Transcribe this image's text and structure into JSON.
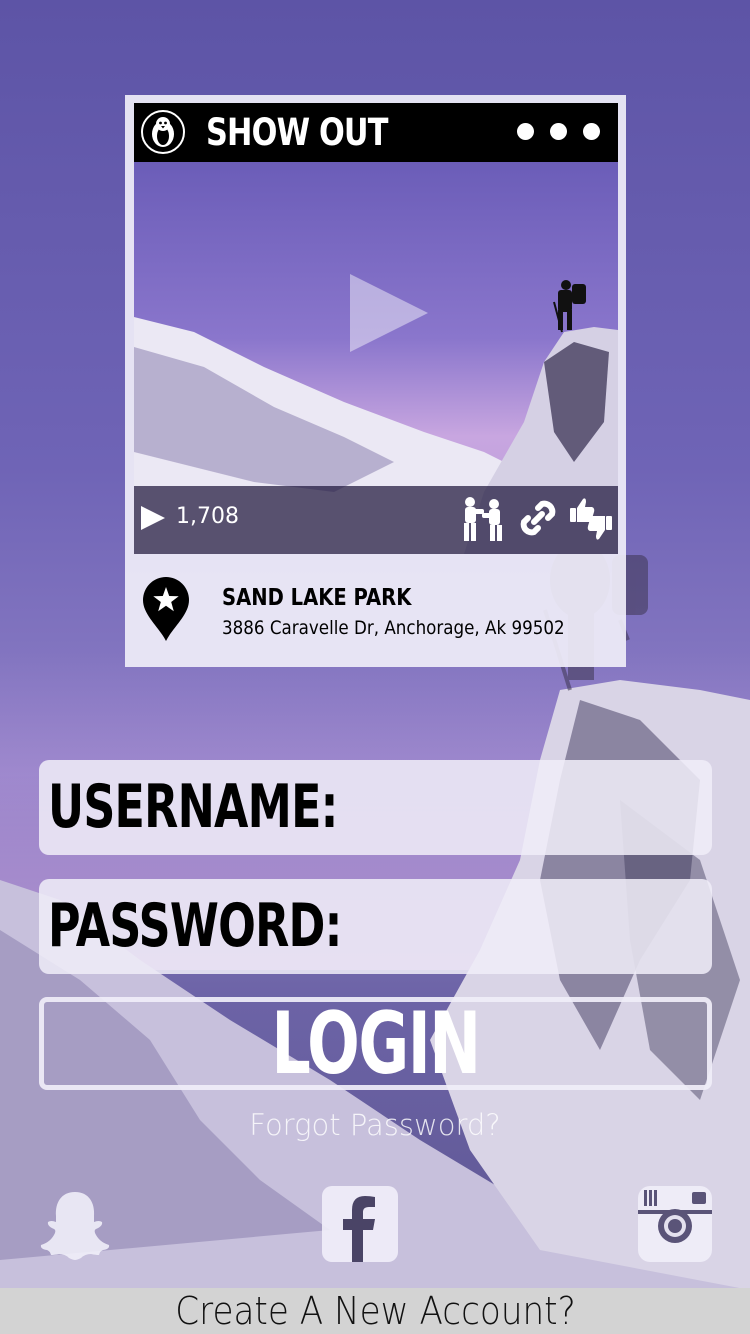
{
  "card": {
    "brand": "SHOW OUT",
    "views": "1,708",
    "location": {
      "name": "SAND LAKE PARK",
      "address": "3886 Caravelle Dr, Anchorage, Ak 99502"
    },
    "icons": [
      "penguin-icon",
      "more-icon",
      "play-icon",
      "boxing-icon",
      "link-icon",
      "thumbs-icon",
      "location-pin-icon"
    ]
  },
  "form": {
    "username_label": "USERNAME:",
    "password_label": "PASSWORD:",
    "login_label": "LOGIN",
    "forgot_label": "Forgot Password?"
  },
  "social": [
    "snapchat-icon",
    "facebook-icon",
    "instagram-icon"
  ],
  "footer": {
    "create_label": "Create A New Account?"
  },
  "colors": {
    "background": "#6f64b6",
    "card_bg": "#f0eef8",
    "header_bg": "#000000",
    "footer_bg": "#d3d3d3"
  }
}
